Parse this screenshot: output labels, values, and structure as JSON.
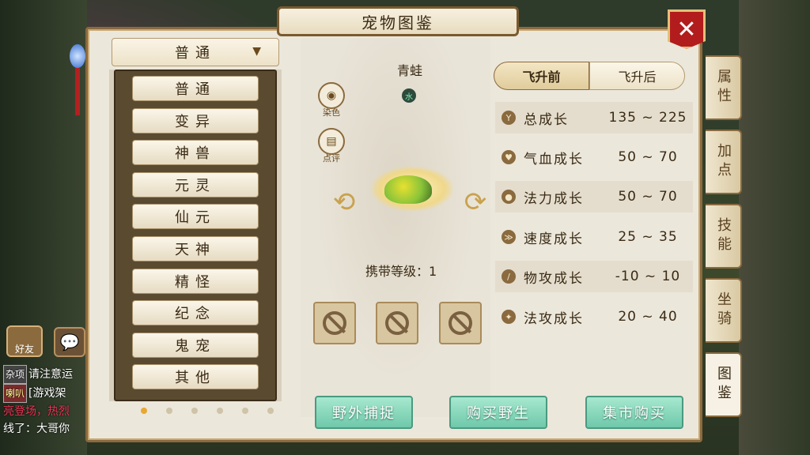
{
  "window": {
    "title": "宠物图鉴"
  },
  "dropdown": {
    "selected": "普通",
    "arrow": "▼"
  },
  "categories": [
    "普通",
    "变异",
    "神兽",
    "元灵",
    "仙元",
    "天神",
    "精怪",
    "纪念",
    "鬼宠",
    "其他"
  ],
  "pager": {
    "total": 6,
    "current": 0
  },
  "pet": {
    "name": "青蛙",
    "element": "水",
    "carry_label": "携带等级：",
    "carry_level": "1",
    "dye_label": "染色",
    "review_label": "点评"
  },
  "tabs": [
    "飞升前",
    "飞升后"
  ],
  "stats": [
    {
      "label": "总成长",
      "range": "135 ~ 225",
      "icon": "Y"
    },
    {
      "label": "气血成长",
      "range": "50 ~ 70",
      "icon": "♥"
    },
    {
      "label": "法力成长",
      "range": "50 ~ 70",
      "icon": "●"
    },
    {
      "label": "速度成长",
      "range": "25 ~ 35",
      "icon": "≫"
    },
    {
      "label": "物攻成长",
      "range": "-10 ~ 10",
      "icon": "/"
    },
    {
      "label": "法攻成长",
      "range": "20 ~ 40",
      "icon": "✦"
    }
  ],
  "actions": {
    "wild_catch": "野外捕捉",
    "buy_wild": "购买野生",
    "market_buy": "集市购买"
  },
  "side_tabs": [
    "属性",
    "加点",
    "技能",
    "坐骑",
    "图鉴"
  ],
  "chat": {
    "friend_label": "好友",
    "line1_tag": "杂项",
    "line1_text": "请注意运",
    "line2_tag": "喇叭",
    "line2_text": "[游戏架",
    "line3_text": "亮登场，热烈",
    "line4_text": "线了：大哥你"
  },
  "colors": {
    "accent": "#b31c1c",
    "action": "#6fc8aa",
    "dot_active": "#e7a832"
  }
}
